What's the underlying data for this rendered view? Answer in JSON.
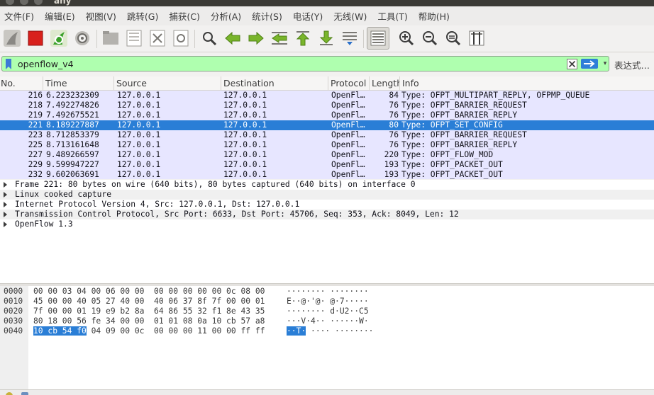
{
  "window": {
    "title": "any"
  },
  "menu": [
    "文件(F)",
    "编辑(E)",
    "视图(V)",
    "跳转(G)",
    "捕获(C)",
    "分析(A)",
    "统计(S)",
    "电话(Y)",
    "无线(W)",
    "工具(T)",
    "帮助(H)"
  ],
  "toolbar": {
    "icons": [
      "shark-fin-start-icon",
      "stop-capture-icon",
      "restart-capture-icon",
      "capture-options-icon",
      "open-file-icon",
      "save-file-icon",
      "close-file-icon",
      "reload-file-icon",
      "find-packet-icon",
      "go-back-icon",
      "go-forward-icon",
      "go-to-packet-icon",
      "first-packet-icon",
      "last-packet-icon",
      "autoscroll-icon",
      "colorize-icon",
      "zoom-in-icon",
      "zoom-out-icon",
      "normal-size-icon",
      "resize-columns-icon"
    ]
  },
  "filter": {
    "value": "openflow_v4",
    "background": "#afffaf",
    "expression_label": "表达式…"
  },
  "packet_list": {
    "columns": [
      "No.",
      "Time",
      "Source",
      "Destination",
      "Protocol",
      "Length",
      "Info"
    ],
    "rows": [
      {
        "no": "216",
        "time": "6.223232309",
        "src": "127.0.0.1",
        "dst": "127.0.0.1",
        "proto": "OpenFl…",
        "len": "84",
        "info": "Type: OFPT_MULTIPART_REPLY, OFPMP_QUEUE"
      },
      {
        "no": "218",
        "time": "7.492274826",
        "src": "127.0.0.1",
        "dst": "127.0.0.1",
        "proto": "OpenFl…",
        "len": "76",
        "info": "Type: OFPT_BARRIER_REQUEST"
      },
      {
        "no": "219",
        "time": "7.492675521",
        "src": "127.0.0.1",
        "dst": "127.0.0.1",
        "proto": "OpenFl…",
        "len": "76",
        "info": "Type: OFPT_BARRIER_REPLY"
      },
      {
        "no": "221",
        "time": "8.189227887",
        "src": "127.0.0.1",
        "dst": "127.0.0.1",
        "proto": "OpenFl…",
        "len": "80",
        "info": "Type: OFPT_SET_CONFIG"
      },
      {
        "no": "223",
        "time": "8.712853379",
        "src": "127.0.0.1",
        "dst": "127.0.0.1",
        "proto": "OpenFl…",
        "len": "76",
        "info": "Type: OFPT_BARRIER_REQUEST"
      },
      {
        "no": "225",
        "time": "8.713161648",
        "src": "127.0.0.1",
        "dst": "127.0.0.1",
        "proto": "OpenFl…",
        "len": "76",
        "info": "Type: OFPT_BARRIER_REPLY"
      },
      {
        "no": "227",
        "time": "9.489266597",
        "src": "127.0.0.1",
        "dst": "127.0.0.1",
        "proto": "OpenFl…",
        "len": "220",
        "info": "Type: OFPT_FLOW_MOD"
      },
      {
        "no": "229",
        "time": "9.599947227",
        "src": "127.0.0.1",
        "dst": "127.0.0.1",
        "proto": "OpenFl…",
        "len": "193",
        "info": "Type: OFPT_PACKET_OUT"
      },
      {
        "no": "232",
        "time": "9.602063691",
        "src": "127.0.0.1",
        "dst": "127.0.0.1",
        "proto": "OpenFl…",
        "len": "193",
        "info": "Type: OFPT_PACKET_OUT"
      }
    ],
    "selected_no": "221",
    "row_color": "#e7e6ff",
    "selected_color": "#2a7ed6"
  },
  "details": [
    "Frame 221: 80 bytes on wire (640 bits), 80 bytes captured (640 bits) on interface 0",
    "Linux cooked capture",
    "Internet Protocol Version 4, Src: 127.0.0.1, Dst: 127.0.0.1",
    "Transmission Control Protocol, Src Port: 6633, Dst Port: 45706, Seq: 353, Ack: 8049, Len: 12",
    "OpenFlow 1.3"
  ],
  "bytes": [
    {
      "offset": "0000",
      "hex_a": "00 00 03 04 00 06 00 00  00 00 00 00 00 0c 08 00",
      "hex_b": "",
      "ascii_a": "········ ········",
      "ascii_b": ""
    },
    {
      "offset": "0010",
      "hex_a": "45 00 00 40 05 27 40 00  40 06 37 8f 7f 00 00 01",
      "hex_b": "",
      "ascii_a": "E··@·'@· @·7·····",
      "ascii_b": ""
    },
    {
      "offset": "0020",
      "hex_a": "7f 00 00 01 19 e9 b2 8a  64 86 55 32 f1 8e 43 35",
      "hex_b": "",
      "ascii_a": "········ d·U2··C5",
      "ascii_b": ""
    },
    {
      "offset": "0030",
      "hex_a": "80 18 00 56 fe 34 00 00  01 01 08 0a 10 cb 57 a8",
      "hex_b": "",
      "ascii_a": "···V·4·· ······W·",
      "ascii_b": ""
    },
    {
      "offset": "0040",
      "hex_a": "10 cb 54 f0",
      "hex_b": " 04 09 00 0c  00 00 00 11 00 00 ff ff",
      "ascii_a": "··T·",
      "ascii_b": "···· ········"
    }
  ]
}
